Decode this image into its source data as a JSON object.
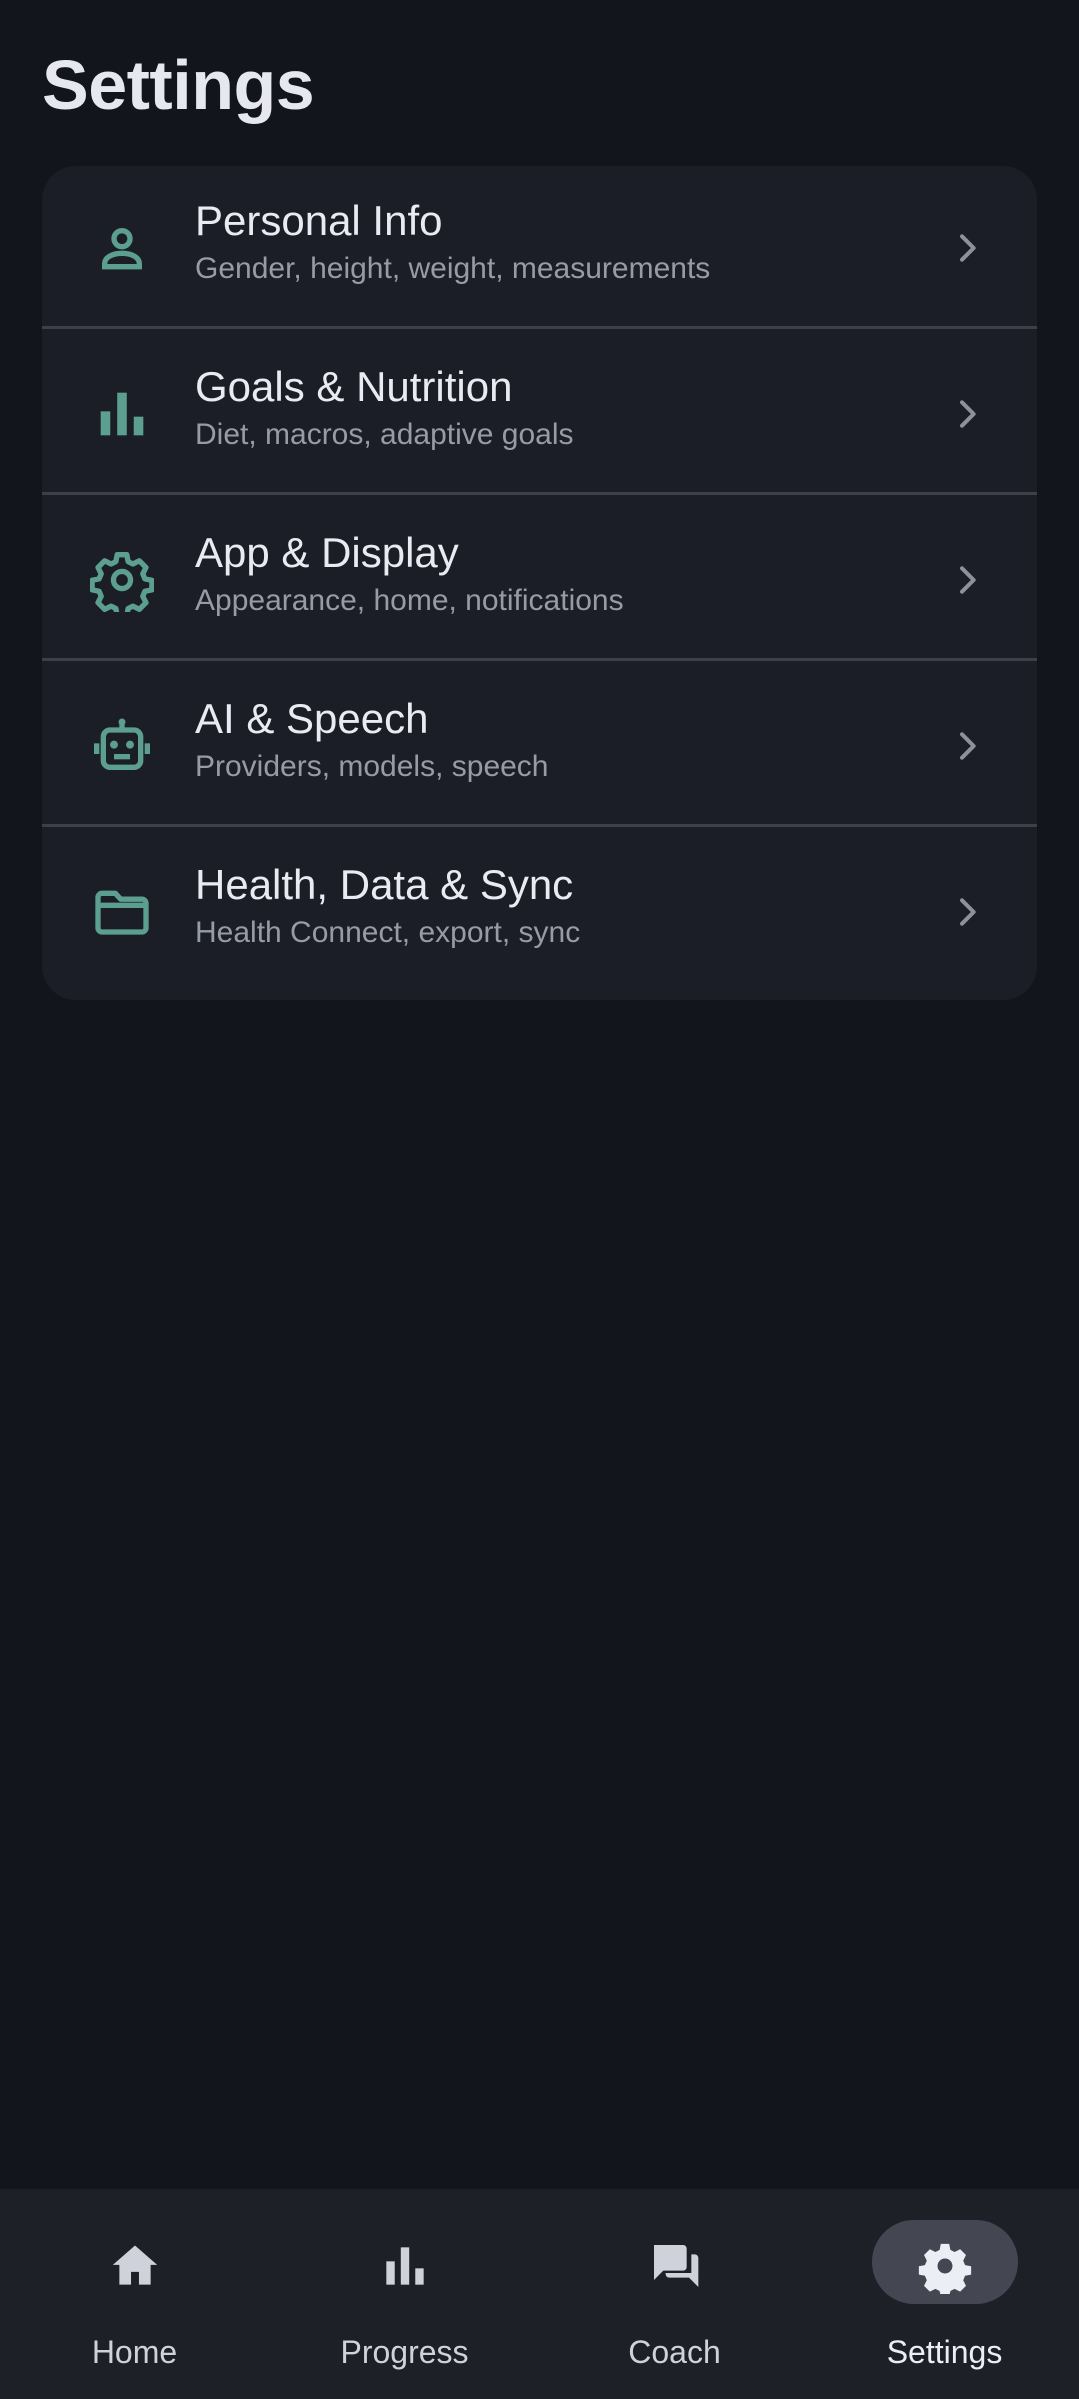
{
  "page": {
    "title": "Settings"
  },
  "colors": {
    "background": "#12151c",
    "card": "#1b1e26",
    "accent_icon": "#5c9e90",
    "title_text": "#e9eaf2",
    "subtitle_text": "#989ba5",
    "nav_bar": "#1e2028",
    "nav_active_pill": "#444751"
  },
  "settings": {
    "items": [
      {
        "icon": "person-icon",
        "title": "Personal Info",
        "subtitle": "Gender, height, weight, measurements"
      },
      {
        "icon": "bar-chart-icon",
        "title": "Goals & Nutrition",
        "subtitle": "Diet, macros, adaptive goals"
      },
      {
        "icon": "gear-icon",
        "title": "App & Display",
        "subtitle": "Appearance, home, notifications"
      },
      {
        "icon": "robot-icon",
        "title": "AI & Speech",
        "subtitle": "Providers, models, speech"
      },
      {
        "icon": "folder-icon",
        "title": "Health, Data & Sync",
        "subtitle": "Health Connect, export, sync"
      }
    ]
  },
  "nav": {
    "items": [
      {
        "icon": "home-icon",
        "label": "Home",
        "active": false
      },
      {
        "icon": "bar-chart-icon",
        "label": "Progress",
        "active": false
      },
      {
        "icon": "chat-bubbles-icon",
        "label": "Coach",
        "active": false
      },
      {
        "icon": "gear-icon",
        "label": "Settings",
        "active": true
      }
    ]
  }
}
